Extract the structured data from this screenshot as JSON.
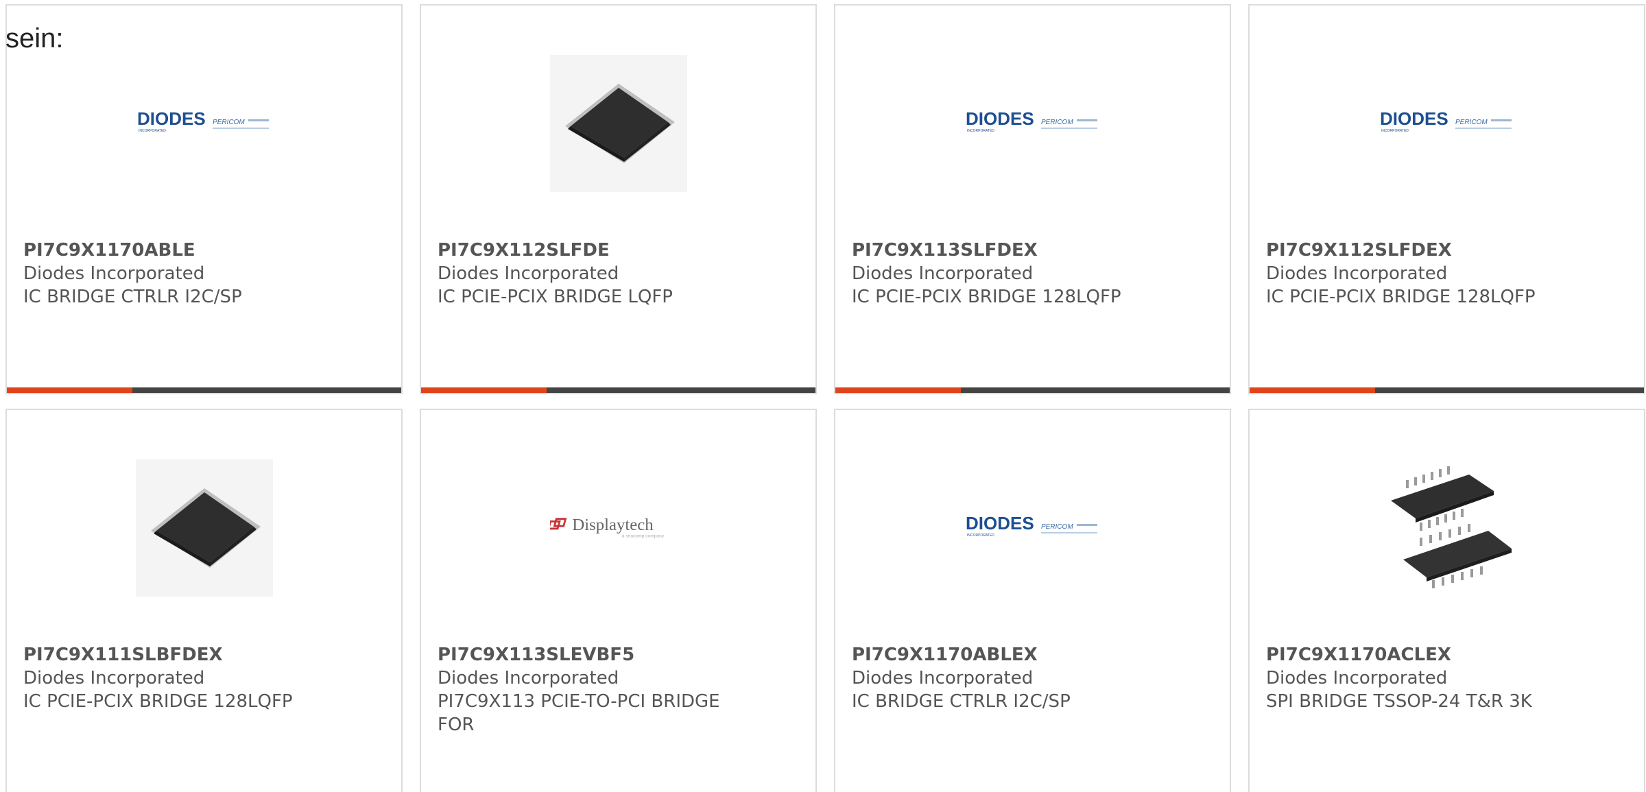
{
  "intro_text": "sein:",
  "products": [
    {
      "part": "PI7C9X1170ABLE",
      "manufacturer": "Diodes Incorporated",
      "description": "IC BRIDGE CTRLR I2C/SP",
      "image": "diodes-pericom-logo"
    },
    {
      "part": "PI7C9X112SLFDE",
      "manufacturer": "Diodes Incorporated",
      "description": "IC PCIE-PCIX BRIDGE LQFP",
      "image": "lqfp-chip"
    },
    {
      "part": "PI7C9X113SLFDEX",
      "manufacturer": "Diodes Incorporated",
      "description": "IC PCIE-PCIX BRIDGE 128LQFP",
      "image": "diodes-pericom-logo"
    },
    {
      "part": "PI7C9X112SLFDEX",
      "manufacturer": "Diodes Incorporated",
      "description": "IC PCIE-PCIX BRIDGE 128LQFP",
      "image": "diodes-pericom-logo"
    },
    {
      "part": "PI7C9X111SLBFDEX",
      "manufacturer": "Diodes Incorporated",
      "description": "IC PCIE-PCIX BRIDGE 128LQFP",
      "image": "lqfp-chip"
    },
    {
      "part": "PI7C9X113SLEVBF5",
      "manufacturer": "Diodes Incorporated",
      "description": "PI7C9X113 PCIE-TO-PCI BRIDGE FOR",
      "image": "displaytech-logo"
    },
    {
      "part": "PI7C9X1170ABLEX",
      "manufacturer": "Diodes Incorporated",
      "description": "IC BRIDGE CTRLR I2C/SP",
      "image": "diodes-pericom-logo"
    },
    {
      "part": "PI7C9X1170ACLEX",
      "manufacturer": "Diodes Incorporated",
      "description": "SPI BRIDGE TSSOP-24 T&R 3K",
      "image": "tssop-chips"
    }
  ],
  "logos": {
    "diodes": {
      "name": "DIODES",
      "sub": "INCORPORATED",
      "partner": "PERICOM"
    },
    "displaytech": {
      "name": "Displaytech",
      "sub": "a seacomp company"
    }
  },
  "colors": {
    "accent_red": "#e0441b",
    "accent_dark": "#444444",
    "card_border": "#dcdcdc",
    "text": "#555555",
    "diodes_blue": "#1d4f91"
  }
}
